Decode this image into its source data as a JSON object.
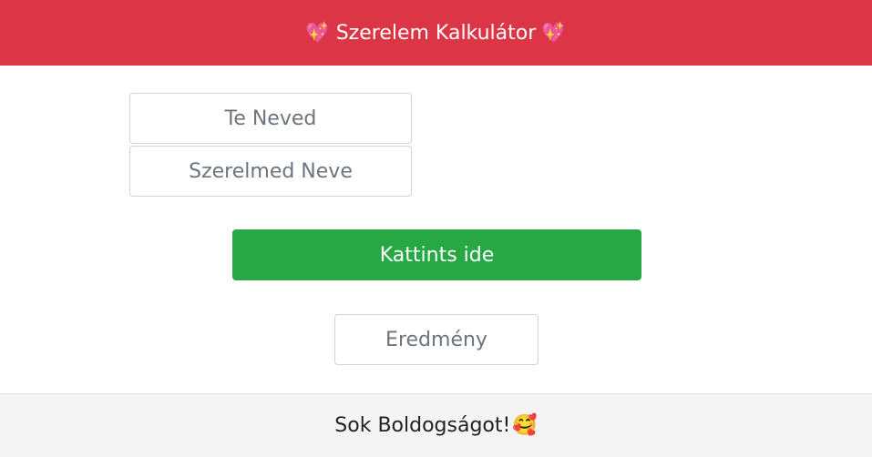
{
  "header": {
    "title": "Szerelem Kalkulátor",
    "left_emoji": "💖",
    "right_emoji": "💖",
    "background": "#dc3545"
  },
  "form": {
    "name_placeholder": "Te Neved",
    "partner_placeholder": "Szerelmed Neve",
    "submit_label": "Kattints ide",
    "submit_color": "#28a745",
    "result_placeholder": "Eredmény"
  },
  "footer": {
    "text": "Sok Boldogságot!",
    "emoji": "🥰"
  }
}
